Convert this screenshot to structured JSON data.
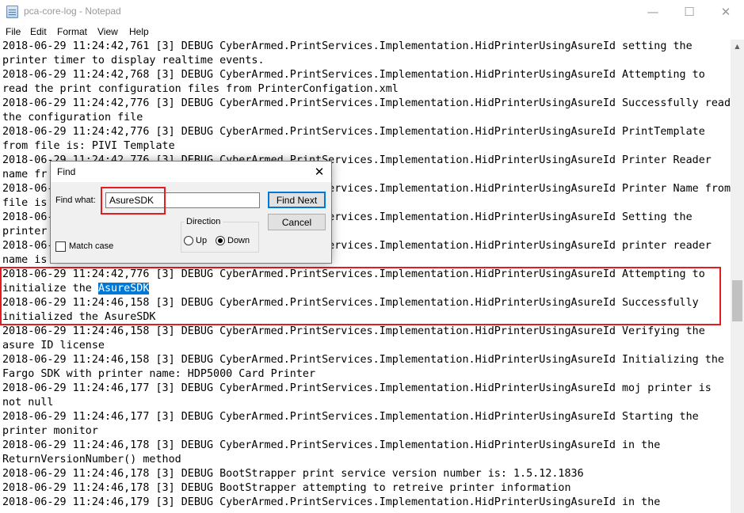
{
  "window": {
    "title": "pca-core-log - Notepad",
    "minimize_glyph": "—",
    "maximize_glyph": "☐",
    "close_glyph": "✕"
  },
  "menu": [
    "File",
    "Edit",
    "Format",
    "View",
    "Help"
  ],
  "log_lines": [
    "2018-06-29 11:24:42,761 [3] DEBUG CyberArmed.PrintServices.Implementation.HidPrinterUsingAsureId setting the",
    "printer timer to display realtime events.",
    "2018-06-29 11:24:42,768 [3] DEBUG CyberArmed.PrintServices.Implementation.HidPrinterUsingAsureId Attempting to",
    "read the print configuration files from PrinterConfigation.xml",
    "2018-06-29 11:24:42,776 [3] DEBUG CyberArmed.PrintServices.Implementation.HidPrinterUsingAsureId Successfully read",
    "the configuration file",
    "2018-06-29 11:24:42,776 [3] DEBUG CyberArmed.PrintServices.Implementation.HidPrinterUsingAsureId PrintTemplate",
    "from file is: PIVI Template",
    "2018-06-29 11:24:42,776 [3] DEBUG CyberArmed.PrintServices.Implementation.HidPrinterUsingAsureId Printer Reader",
    "name fr",
    "2018-06-29 11:24:42,776 [3] DEBUG CyberArmed.PrintServices.Implementation.HidPrinterUsingAsureId Printer Name from",
    "file is",
    "2018-06-29 11:24:42,776 [3] DEBUG CyberArmed.PrintServices.Implementation.HidPrinterUsingAsureId Setting the",
    "printer",
    "2018-06-29 11:24:42,776 [3] DEBUG CyberArmed.PrintServices.Implementation.HidPrinterUsingAsureId printer reader",
    "name is",
    "2018-06-29 11:24:42,776 [3] DEBUG CyberArmed.PrintServices.Implementation.HidPrinterUsingAsureId Attempting to",
    "initialize the ",
    "2018-06-29 11:24:46,158 [3] DEBUG CyberArmed.PrintServices.Implementation.HidPrinterUsingAsureId Successfully",
    "initialized the AsureSDK",
    "2018-06-29 11:24:46,158 [3] DEBUG CyberArmed.PrintServices.Implementation.HidPrinterUsingAsureId Verifying the",
    "asure ID license",
    "2018-06-29 11:24:46,158 [3] DEBUG CyberArmed.PrintServices.Implementation.HidPrinterUsingAsureId Initializing the",
    "Fargo SDK with printer name: HDP5000 Card Printer",
    "2018-06-29 11:24:46,177 [3] DEBUG CyberArmed.PrintServices.Implementation.HidPrinterUsingAsureId moj printer is",
    "not null",
    "2018-06-29 11:24:46,177 [3] DEBUG CyberArmed.PrintServices.Implementation.HidPrinterUsingAsureId Starting the",
    "printer monitor",
    "2018-06-29 11:24:46,178 [3] DEBUG CyberArmed.PrintServices.Implementation.HidPrinterUsingAsureId in the",
    "ReturnVersionNumber() method",
    "2018-06-29 11:24:46,178 [3] DEBUG BootStrapper print service version number is: 1.5.12.1836",
    "2018-06-29 11:24:46,178 [3] DEBUG BootStrapper attempting to retreive printer information",
    "2018-06-29 11:24:46,179 [3] DEBUG CyberArmed.PrintServices.Implementation.HidPrinterUsingAsureId in the"
  ],
  "selection": {
    "line_index": 17,
    "text": "AsureSDK"
  },
  "find_dialog": {
    "title": "Find",
    "close_glyph": "✕",
    "find_what_label": "Find what:",
    "find_what_value": "AsureSDK",
    "find_next_label": "Find Next",
    "cancel_label": "Cancel",
    "direction_label": "Direction",
    "up_label": "Up",
    "down_label": "Down",
    "direction_selected": "Down",
    "match_case_label": "Match case",
    "match_case_checked": false
  },
  "scrollbar": {
    "up_arrow_glyph": "▲"
  },
  "colors": {
    "selection": "#0078d7",
    "highlight_box": "#e31b23"
  }
}
